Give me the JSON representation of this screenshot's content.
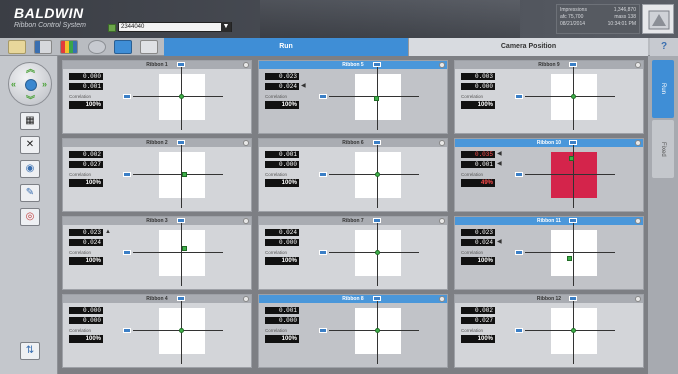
{
  "app": {
    "brand": "BALDWIN",
    "subtitle": "Ribbon Control System",
    "job_value": "2344040"
  },
  "status": {
    "lines": [
      [
        "Impressions",
        "1,346,870"
      ],
      [
        "afc 75,700",
        "mass 138"
      ],
      [
        "08/21/2014",
        "10:34:01 PM"
      ]
    ]
  },
  "tabs": {
    "run": "Run",
    "camera_position": "Camera Position",
    "help": "?"
  },
  "right_tabs": [
    "Run",
    "Fixed"
  ],
  "colors": {
    "accent_blue": "#3f8ed6",
    "alert_red": "#d4244b",
    "marker_green": "#3fb04a"
  },
  "panels": [
    {
      "title": "Ribbon 1",
      "v1": "0.000",
      "v2": "0.001",
      "a1": "",
      "a2": "",
      "corr_label": "Correlation",
      "corr": "100%",
      "selected": false,
      "alert": false
    },
    {
      "title": "Ribbon 5",
      "v1": "0.023",
      "v2": "0.024",
      "a1": "",
      "a2": "◀",
      "corr_label": "Correlation",
      "corr": "100%",
      "selected": true,
      "alert": false
    },
    {
      "title": "Ribbon 9",
      "v1": "0.003",
      "v2": "0.000",
      "a1": "",
      "a2": "",
      "corr_label": "Correlation",
      "corr": "100%",
      "selected": false,
      "alert": false
    },
    {
      "title": "Ribbon 2",
      "v1": "0.002",
      "v2": "0.027",
      "a1": "",
      "a2": "",
      "corr_label": "Correlation",
      "corr": "100%",
      "selected": false,
      "alert": false
    },
    {
      "title": "Ribbon 6",
      "v1": "0.001",
      "v2": "0.000",
      "a1": "",
      "a2": "",
      "corr_label": "Correlation",
      "corr": "100%",
      "selected": false,
      "alert": false
    },
    {
      "title": "Ribbon 10",
      "v1": "0.035",
      "v2": "0.001",
      "a1": "◀",
      "a2": "◀",
      "corr_label": "Correlation",
      "corr": "49%",
      "selected": true,
      "alert": true
    },
    {
      "title": "Ribbon 3",
      "v1": "0.023",
      "v2": "0.024",
      "a1": "▲",
      "a2": "",
      "corr_label": "Correlation",
      "corr": "100%",
      "selected": false,
      "alert": false
    },
    {
      "title": "Ribbon 7",
      "v1": "0.024",
      "v2": "0.000",
      "a1": "",
      "a2": "",
      "corr_label": "Correlation",
      "corr": "100%",
      "selected": false,
      "alert": false
    },
    {
      "title": "Ribbon 11",
      "v1": "0.023",
      "v2": "0.024",
      "a1": "",
      "a2": "◀",
      "corr_label": "Correlation",
      "corr": "100%",
      "selected": true,
      "alert": false
    },
    {
      "title": "Ribbon 4",
      "v1": "0.000",
      "v2": "0.000",
      "a1": "",
      "a2": "",
      "corr_label": "Correlation",
      "corr": "100%",
      "selected": false,
      "alert": false
    },
    {
      "title": "Ribbon 8",
      "v1": "0.001",
      "v2": "0.000",
      "a1": "",
      "a2": "",
      "corr_label": "Correlation",
      "corr": "100%",
      "selected": true,
      "alert": false
    },
    {
      "title": "Ribbon 12",
      "v1": "0.002",
      "v2": "0.027",
      "a1": "",
      "a2": "",
      "corr_label": "Correlation",
      "corr": "100%",
      "selected": false,
      "alert": false
    }
  ]
}
